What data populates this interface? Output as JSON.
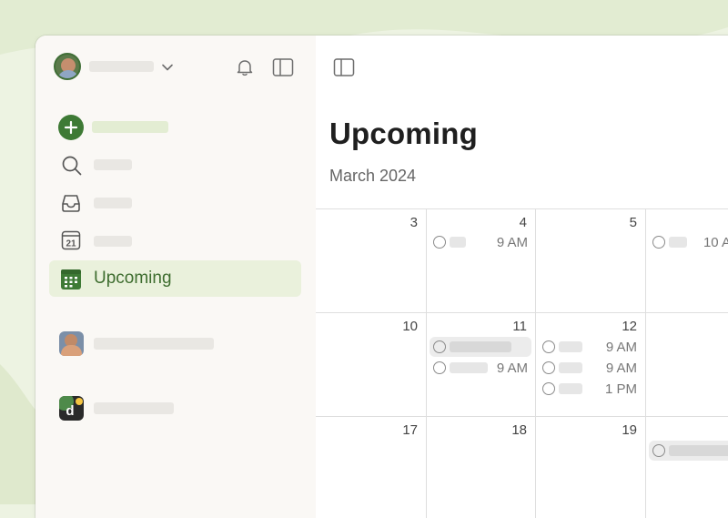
{
  "sidebar": {
    "active_item": {
      "label": "Upcoming"
    }
  },
  "main": {
    "title": "Upcoming",
    "month": "March 2024"
  },
  "calendar": {
    "days": [
      "3",
      "4",
      "5",
      "10",
      "11",
      "12",
      "17",
      "18",
      "19"
    ],
    "tasks": {
      "d4_t1_time": "9 AM",
      "d6_t1_time": "10 A",
      "d11_t2_time": "9 AM",
      "d12_t1_time": "9 AM",
      "d12_t2_time": "9 AM",
      "d12_t3_time": "1 PM"
    }
  },
  "colors": {
    "accent": "#3e7a35",
    "active_bg": "#eaf1dc",
    "sidebar_bg": "#faf8f5"
  },
  "icons": [
    "user-avatar",
    "chevron-down-icon",
    "bell-icon",
    "sidebar-toggle-icon",
    "add-task-icon",
    "search-icon",
    "inbox-icon",
    "today-calendar-icon",
    "upcoming-calendar-icon",
    "project-avatar",
    "workspace-logo"
  ]
}
